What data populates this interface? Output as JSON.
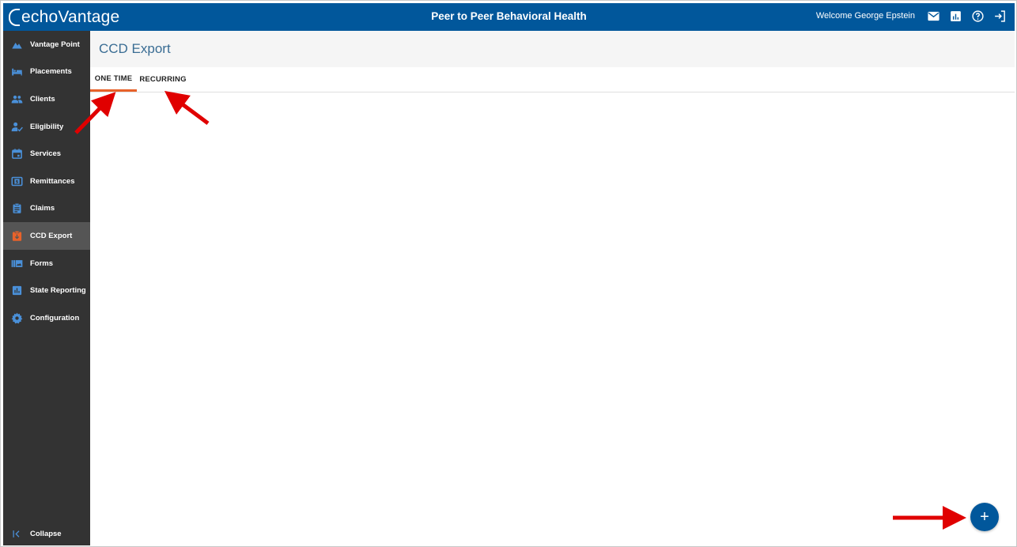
{
  "header": {
    "logo_text": "echoVantage",
    "app_title": "Peer to Peer Behavioral Health",
    "welcome": "Welcome George Epstein",
    "icons": [
      "mail-icon",
      "report-icon",
      "help-icon",
      "logout-icon"
    ]
  },
  "sidebar": {
    "items": [
      {
        "label": "Vantage Point",
        "icon": "mountain-icon"
      },
      {
        "label": "Placements",
        "icon": "bed-icon"
      },
      {
        "label": "Clients",
        "icon": "people-icon"
      },
      {
        "label": "Eligibility",
        "icon": "person-check-icon"
      },
      {
        "label": "Services",
        "icon": "calendar-icon"
      },
      {
        "label": "Remittances",
        "icon": "dollar-icon"
      },
      {
        "label": "Claims",
        "icon": "clipboard-icon"
      },
      {
        "label": "CCD Export",
        "icon": "export-icon",
        "active": true
      },
      {
        "label": "Forms",
        "icon": "forms-icon"
      },
      {
        "label": "State Reporting",
        "icon": "chart-icon"
      },
      {
        "label": "Configuration",
        "icon": "gear-icon"
      }
    ],
    "collapse_label": "Collapse"
  },
  "page": {
    "title": "CCD Export",
    "tabs": [
      {
        "label": "ONE TIME",
        "active": true
      },
      {
        "label": "RECURRING",
        "active": false
      }
    ]
  },
  "fab": {
    "label": "+"
  },
  "colors": {
    "brand": "#01579b",
    "accent": "#e8622a",
    "sidebar": "#333333",
    "icon_blue": "#4a90d9",
    "annotation": "#e00000"
  }
}
